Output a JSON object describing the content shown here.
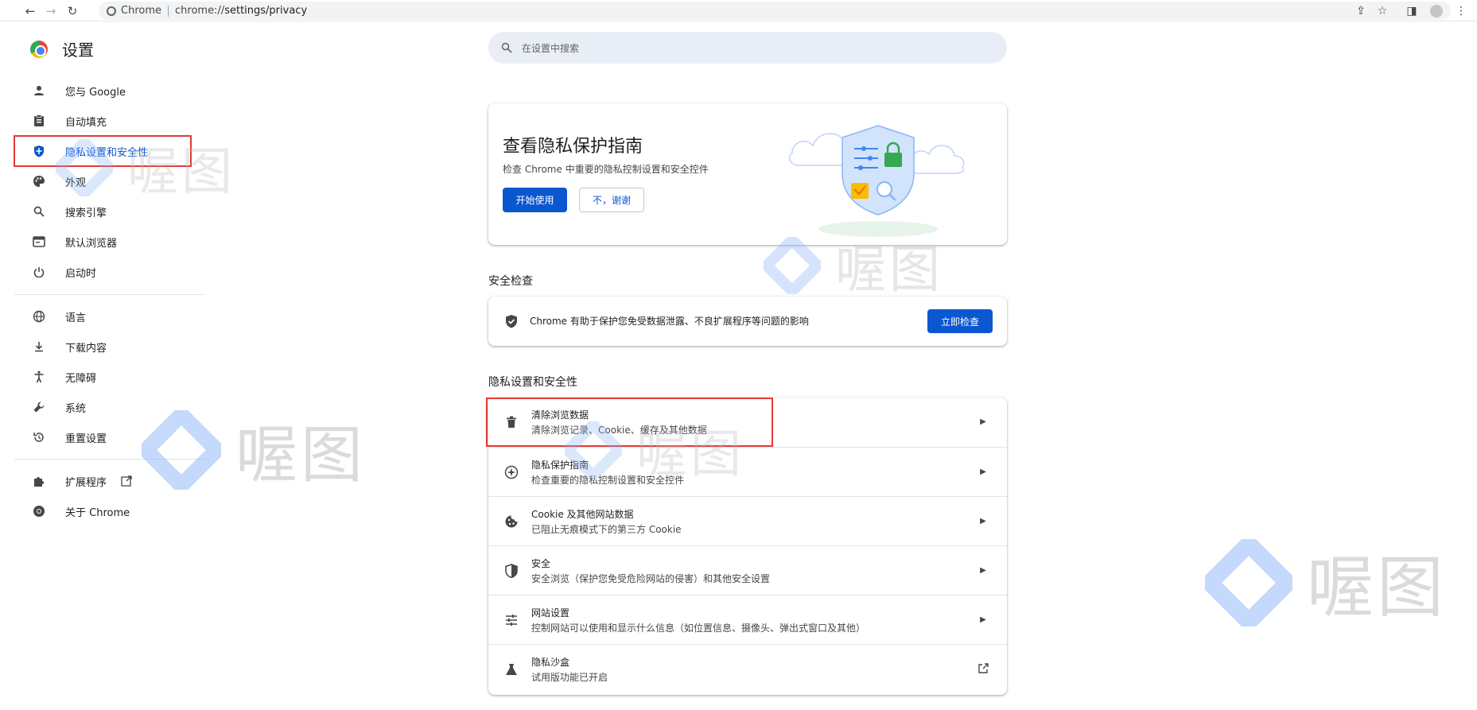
{
  "browser": {
    "site_chip": "Chrome",
    "url_prefix": "chrome://",
    "url_path": "settings/privacy"
  },
  "sidebar": {
    "title": "设置",
    "items": [
      {
        "label": "您与 Google",
        "icon": "person-icon"
      },
      {
        "label": "自动填充",
        "icon": "clipboard-icon"
      },
      {
        "label": "隐私设置和安全性",
        "icon": "shield-icon",
        "active": true
      },
      {
        "label": "外观",
        "icon": "palette-icon"
      },
      {
        "label": "搜索引擎",
        "icon": "search-icon"
      },
      {
        "label": "默认浏览器",
        "icon": "browser-icon"
      },
      {
        "label": "启动时",
        "icon": "power-icon"
      },
      {
        "label": "语言",
        "icon": "globe-icon"
      },
      {
        "label": "下载内容",
        "icon": "download-icon"
      },
      {
        "label": "无障碍",
        "icon": "accessibility-icon"
      },
      {
        "label": "系统",
        "icon": "wrench-icon"
      },
      {
        "label": "重置设置",
        "icon": "reset-icon"
      },
      {
        "label": "扩展程序",
        "icon": "puzzle-icon"
      },
      {
        "label": "关于 Chrome",
        "icon": "chrome-icon"
      }
    ]
  },
  "search": {
    "placeholder": "在设置中搜索"
  },
  "privacy_guide": {
    "title": "查看隐私保护指南",
    "subtitle": "检查 Chrome 中重要的隐私控制设置和安全控件",
    "primary_button": "开始使用",
    "secondary_button": "不，谢谢"
  },
  "safety_check": {
    "section_title": "安全检查",
    "text": "Chrome 有助于保护您免受数据泄露、不良扩展程序等问题的影响",
    "button": "立即检查"
  },
  "privacy_section": {
    "section_title": "隐私设置和安全性",
    "rows": [
      {
        "title": "清除浏览数据",
        "subtitle": "清除浏览记录、Cookie、缓存及其他数据",
        "icon": "trash-icon"
      },
      {
        "title": "隐私保护指南",
        "subtitle": "检查重要的隐私控制设置和安全控件",
        "icon": "compass-icon"
      },
      {
        "title": "Cookie 及其他网站数据",
        "subtitle": "已阻止无痕模式下的第三方 Cookie",
        "icon": "cookie-icon"
      },
      {
        "title": "安全",
        "subtitle": "安全浏览（保护您免受危险网站的侵害）和其他安全设置",
        "icon": "security-shield-icon"
      },
      {
        "title": "网站设置",
        "subtitle": "控制网站可以使用和显示什么信息（如位置信息、摄像头、弹出式窗口及其他）",
        "icon": "sliders-icon"
      },
      {
        "title": "隐私沙盒",
        "subtitle": "试用版功能已开启",
        "icon": "flask-icon"
      }
    ]
  },
  "watermark": {
    "text": "喔图"
  },
  "colors": {
    "accent": "#0b57d0",
    "annotation": "#e53935"
  }
}
